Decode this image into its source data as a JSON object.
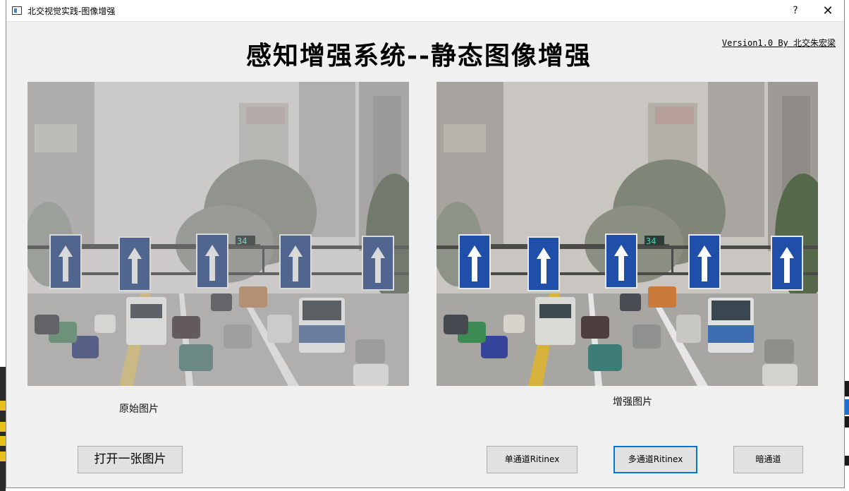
{
  "window": {
    "title": "北交视觉实践-图像增强",
    "help_symbol": "?",
    "close_symbol": "✕"
  },
  "header": {
    "title": "感知增强系统--静态图像增强",
    "version": "Version1.0 By 北交朱宏梁"
  },
  "panels": {
    "original_caption": "原始图片",
    "enhanced_caption": "增强图片",
    "sign_number": "34"
  },
  "buttons": {
    "open_image": "打开一张图片",
    "single_retinex": "单通道Ritinex",
    "multi_retinex": "多通道Ritinex",
    "dark_channel": "暗通道"
  },
  "colors": {
    "sign_blue": "#1f4fa8",
    "focus_border": "#0078d7",
    "window_bg": "#f0f0f0"
  },
  "icons": {
    "app": "app-window-icon",
    "help": "help-icon",
    "close": "close-icon"
  }
}
